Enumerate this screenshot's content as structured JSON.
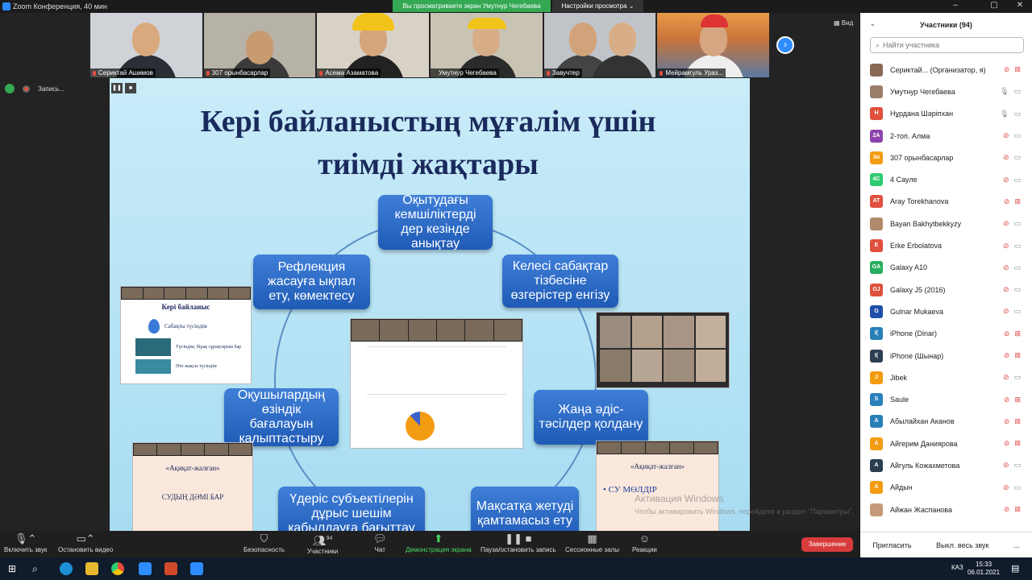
{
  "window": {
    "title": "Zoom Конференция, 40 мин"
  },
  "banner": {
    "share_text": "Вы просматриваете экран Умутнур Чегебаева",
    "view_settings": "Настройки просмотра ⌄",
    "view_label": "Вид"
  },
  "recording": {
    "label": "Запись..."
  },
  "thumbnails": [
    {
      "name": "Сериктай Ашимов",
      "bg": "#cfd3d8"
    },
    {
      "name": "307 орынбасарлар",
      "bg": "#b7b2a6"
    },
    {
      "name": "Асема Азаматова",
      "bg": "#d8d1c5"
    },
    {
      "name": "Умутнур Чегебаева",
      "bg": "#c9c3b4"
    },
    {
      "name": "Завучтер",
      "bg": "#c0c4c9"
    },
    {
      "name": "Мейрамгуль Ураз...",
      "bg": "#f1a04a"
    }
  ],
  "slide": {
    "title_line1": "Кері байланыстың мұғалім үшін",
    "title_line2": "тиімді жақтары",
    "boxes": [
      "Оқытудағы кемшіліктерді дер кезінде анықтау",
      "Келесі сабақтар тізбесіне өзгерістер енгізу",
      "Жаңа әдіс-тәсілдер қолдану",
      "Мақсатқа жетуді қамтамасыз ету",
      "Үдеріс субъектілерін дұрыс шешім қабылдауға бағыттау",
      "Оқушылардың өзіндік бағалауын қалыптастыру",
      "Рефлекция жасауға ықпал ету, көмектесу"
    ],
    "mini1": {
      "title": "Кері байланыс",
      "row1": "Сабақты түсіндім",
      "row2": "Түсіндім, бірақ сұрақтарым бар",
      "row3": "Өте жақсы түсіндім"
    },
    "mini2": {
      "title": "«Ақиқат-жалған»",
      "text": "СУДЫҢ  ДӘМІ БАР"
    },
    "mini3": {
      "title": "«Ақиқат-жалған»",
      "text": "• СУ  МӨЛДІР"
    },
    "watermark1": "Активация Windows",
    "watermark2": "Чтобы активировать Windows, перейдите в раздел \"Параметры\"."
  },
  "participants": {
    "header": "Участники (94)",
    "search_placeholder": "Найти участника",
    "list": [
      {
        "initials": "",
        "name": "Сериктай... (Организатор, я)",
        "color": "#8a6a55",
        "mic": "off",
        "cam": "off"
      },
      {
        "initials": "",
        "name": "Умутнур Чегебаева",
        "color": "#9a7e6a",
        "mic": "on",
        "cam": "on"
      },
      {
        "initials": "Н",
        "name": "Нұрдана Шәріпхан",
        "color": "#e0503c",
        "mic": "on",
        "cam": "on"
      },
      {
        "initials": "2А",
        "name": "2-топ. Алма",
        "color": "#8e44ad",
        "mic": "off",
        "cam": "on"
      },
      {
        "initials": "3о",
        "name": "307 орынбасарлар",
        "color": "#f39c12",
        "mic": "off",
        "cam": "on"
      },
      {
        "initials": "4С",
        "name": "4 Сауле",
        "color": "#2ecc71",
        "mic": "off",
        "cam": "on"
      },
      {
        "initials": "AT",
        "name": "Aray Torekhanova",
        "color": "#e0503c",
        "mic": "off",
        "cam": "off"
      },
      {
        "initials": "",
        "name": "Bayan Bakhytbekkyzy",
        "color": "#b08a6a",
        "mic": "off",
        "cam": "on"
      },
      {
        "initials": "E",
        "name": "Erke Erbolatova",
        "color": "#e0503c",
        "mic": "off",
        "cam": "on"
      },
      {
        "initials": "GA",
        "name": "Galaxy A10",
        "color": "#27ae60",
        "mic": "off",
        "cam": "on"
      },
      {
        "initials": "GJ",
        "name": "Galaxy J5 (2016)",
        "color": "#e0503c",
        "mic": "off",
        "cam": "on"
      },
      {
        "initials": "G",
        "name": "Gulnar Mukaeva",
        "color": "#1f4fa8",
        "mic": "off",
        "cam": "on"
      },
      {
        "initials": "I(",
        "name": "iPhone (Dinar)",
        "color": "#2980b9",
        "mic": "off",
        "cam": "off"
      },
      {
        "initials": "I(",
        "name": "iPhone (Шынар)",
        "color": "#2c3e50",
        "mic": "off",
        "cam": "off"
      },
      {
        "initials": "J",
        "name": "Jibek",
        "color": "#f39c12",
        "mic": "off",
        "cam": "on"
      },
      {
        "initials": "S",
        "name": "Saule",
        "color": "#2980b9",
        "mic": "off",
        "cam": "off"
      },
      {
        "initials": "A",
        "name": "Абылайхан Аканов",
        "color": "#2980b9",
        "mic": "off",
        "cam": "off"
      },
      {
        "initials": "A",
        "name": "Айгерим Даниярова",
        "color": "#f39c12",
        "mic": "off",
        "cam": "off"
      },
      {
        "initials": "A",
        "name": "Айгуль Кожахметова",
        "color": "#2c3e50",
        "mic": "off",
        "cam": "on"
      },
      {
        "initials": "A",
        "name": "Айдын",
        "color": "#f39c12",
        "mic": "off",
        "cam": "on"
      },
      {
        "initials": "",
        "name": "Айжан Жаспанова",
        "color": "#c49a7a",
        "mic": "off",
        "cam": "off"
      }
    ],
    "invite": "Пригласить",
    "mute_all": "Выкл. весь звук",
    "more": "..."
  },
  "toolbar": {
    "audio": "Включить звук",
    "video": "Остановить видео",
    "security": "Безопасность",
    "participants": "Участники",
    "participants_count": "94",
    "chat": "Чат",
    "share": "Демонстрация экрана",
    "record": "Пауза/остановить запись",
    "rooms": "Сессионные залы",
    "reactions": "Реакции",
    "end": "Завершение"
  },
  "taskbar": {
    "time": "15:33",
    "date": "06.01.2021",
    "lang": "КАЗ"
  }
}
